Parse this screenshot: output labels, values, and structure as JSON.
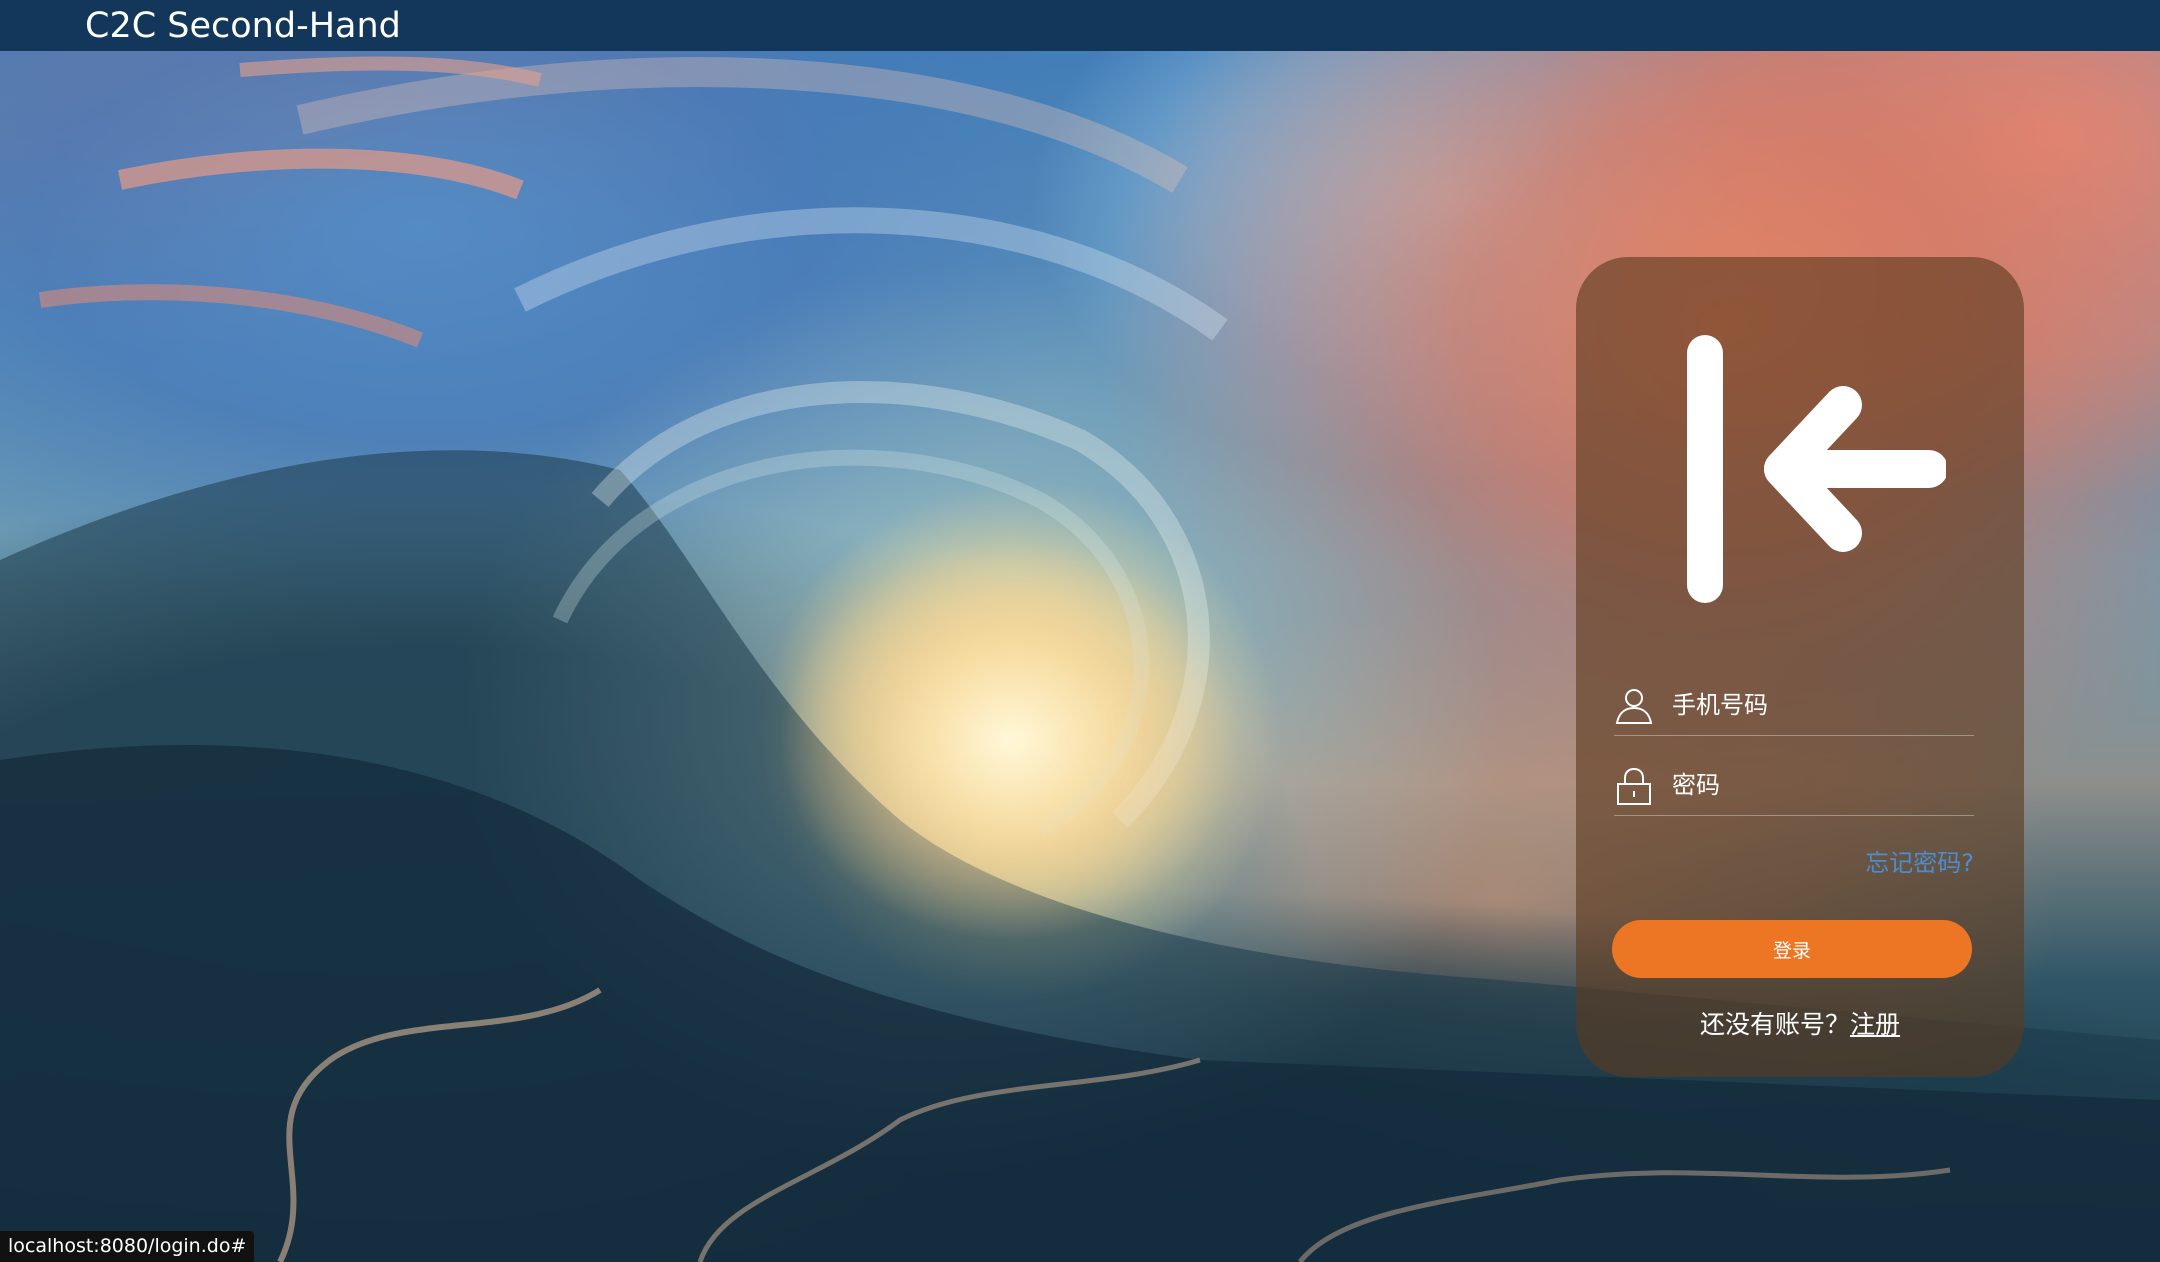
{
  "navbar": {
    "brand": "C2C Second-Hand"
  },
  "login_panel": {
    "logo_icon": "login-arrow-icon",
    "phone_field": {
      "placeholder": "手机号码",
      "value": "",
      "icon": "user-icon"
    },
    "password_field": {
      "placeholder": "密码",
      "value": "",
      "icon": "lock-icon"
    },
    "forgot_password": "忘记密码?",
    "login_button": "登录",
    "register_prompt": "还没有账号？",
    "register_link": "注册"
  },
  "status_bar": {
    "url": "localhost:8080/login.do#"
  },
  "colors": {
    "navbar_bg": "#13365b",
    "button_orange": "#ec7624",
    "link_blue": "#4a8ed1",
    "panel_bg": "rgba(92,58,30,0.62)"
  }
}
